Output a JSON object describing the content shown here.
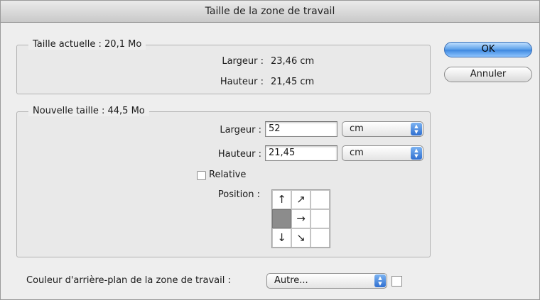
{
  "dialog": {
    "title": "Taille de la zone de travail"
  },
  "current_size": {
    "legend": "Taille actuelle : 20,1 Mo",
    "width_label": "Largeur :",
    "width_value": "23,46 cm",
    "height_label": "Hauteur :",
    "height_value": "21,45 cm"
  },
  "new_size": {
    "legend": "Nouvelle taille : 44,5 Mo",
    "width_label": "Largeur :",
    "width_value": "52",
    "width_unit": "cm",
    "height_label": "Hauteur :",
    "height_value": "21,45",
    "height_unit": "cm",
    "relative_label": "Relative",
    "relative_checked": false,
    "position_label": "Position :",
    "anchor": {
      "selected": "middle-left",
      "arrows": [
        "↑",
        "↗",
        "",
        "",
        "→",
        "",
        "↓",
        "↘",
        ""
      ]
    }
  },
  "background": {
    "label": "Couleur d'arrière-plan de la zone de travail :",
    "value": "Autre...",
    "swatch_color": "#ffffff"
  },
  "buttons": {
    "ok_label": "OK",
    "cancel_label": "Annuler"
  }
}
